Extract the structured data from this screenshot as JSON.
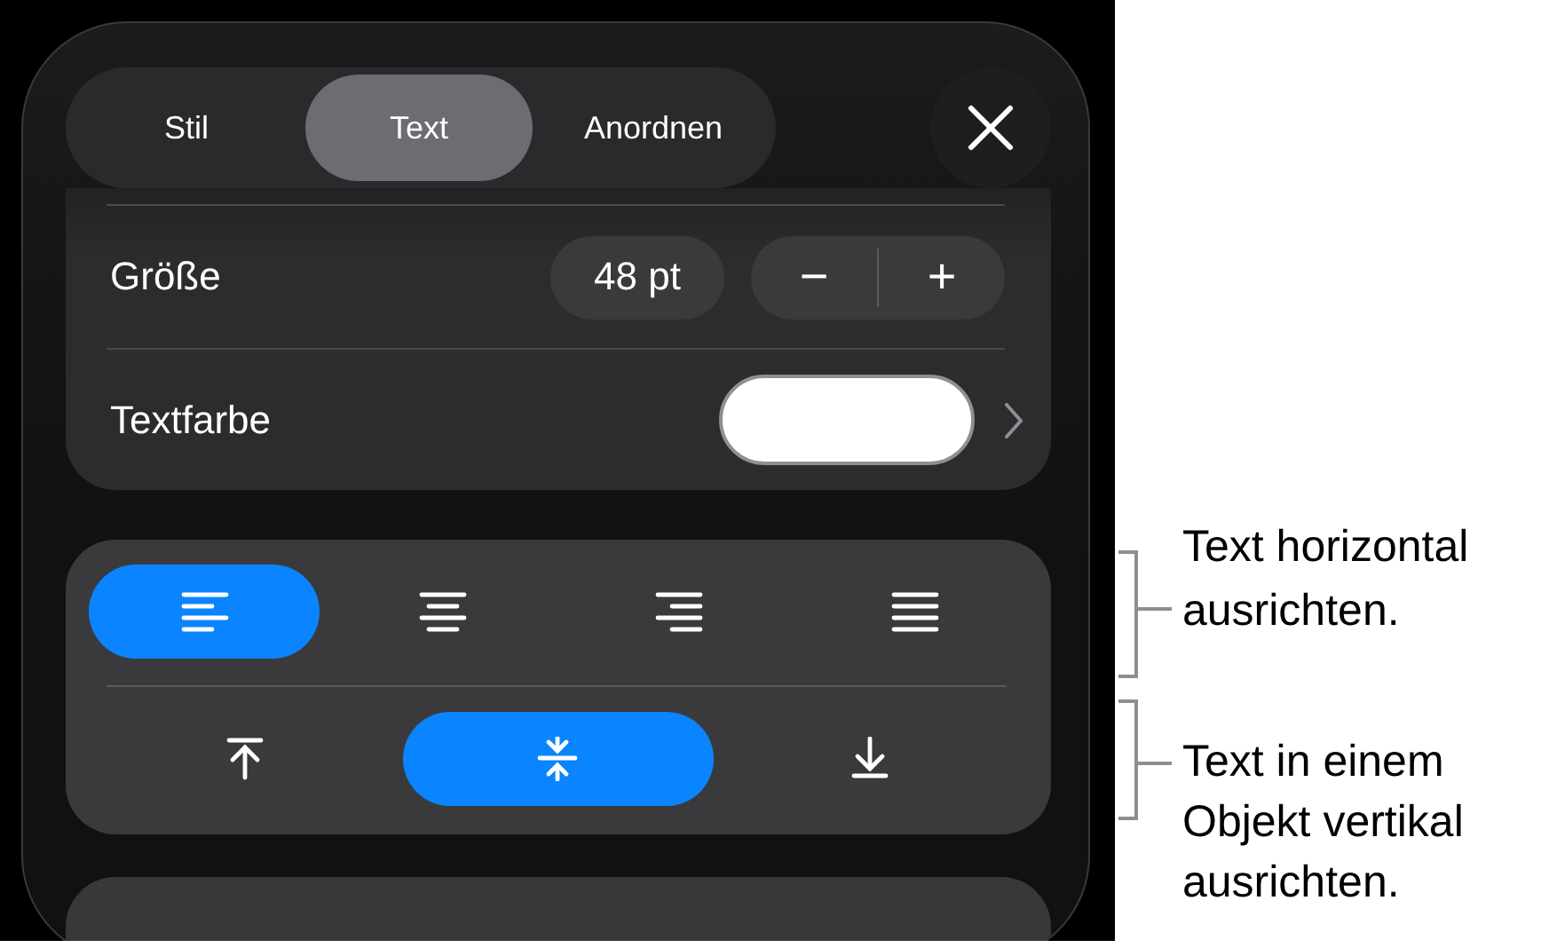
{
  "tabs": [
    {
      "label": "Stil",
      "selected": false
    },
    {
      "label": "Text",
      "selected": true
    },
    {
      "label": "Anordnen",
      "selected": false
    }
  ],
  "size_row": {
    "label": "Größe",
    "value": "48 pt",
    "decrease": "−",
    "increase": "+"
  },
  "text_color_row": {
    "label": "Textfarbe"
  },
  "horizontal_alignment": [
    {
      "kind": "left",
      "selected": true
    },
    {
      "kind": "center",
      "selected": false
    },
    {
      "kind": "right",
      "selected": false
    },
    {
      "kind": "justify",
      "selected": false
    }
  ],
  "vertical_alignment": [
    {
      "kind": "top",
      "selected": false
    },
    {
      "kind": "middle",
      "selected": true
    },
    {
      "kind": "bottom",
      "selected": false
    }
  ],
  "callouts": [
    {
      "text": "Text horizontal ausrichten."
    },
    {
      "text": "Text in einem Objekt vertikal ausrichten."
    }
  ]
}
